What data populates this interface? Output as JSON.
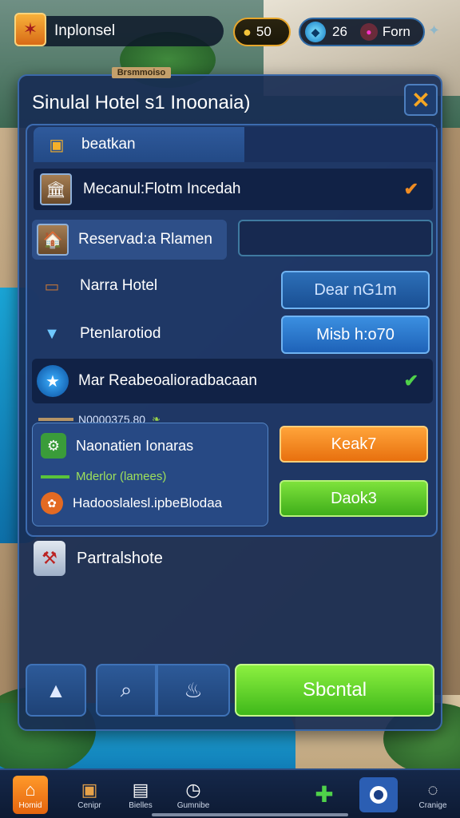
{
  "header": {
    "title": "Inplonsel",
    "coins": "50",
    "gems": "26",
    "profile_label": "Forn"
  },
  "dialog": {
    "sign_text": "Brsmmoiso",
    "title": "Sinulal Hotel s1 Inoonaia)",
    "tab_label": "beatkan",
    "row1_label": "Mecanul:Flotm Incedah",
    "row2_label": "Reservad:a Rlamen",
    "row3_label": "Narra Hotel",
    "row3_button": "Dear nG1m",
    "row4_label": "Ptenlarotiod",
    "row4_button": "Misb h:o70",
    "row5_label": "Mar Reabeoalioradbacaan",
    "price_text": "N0000375.80",
    "sub_item1": "Naonatien Ionaras",
    "sub_item2": "Mderlor (lamees)",
    "sub_item3": "Hadooslalesl.ipbeBlodaa",
    "orange_button": "Keak7",
    "green_button": "Daok3",
    "extra_label": "Partralshote",
    "start_button": "Sbcntal"
  },
  "nav": {
    "home_label": "Homid",
    "item2_label": "Cenipr",
    "item3_label": "Bielles",
    "item4_label": "Gumnibe",
    "item6_label": "Cranige"
  },
  "colors": {
    "panel": "#182c54",
    "accent_orange": "#e8700e",
    "accent_green": "#3fae1a",
    "accent_blue": "#1e62b8"
  }
}
